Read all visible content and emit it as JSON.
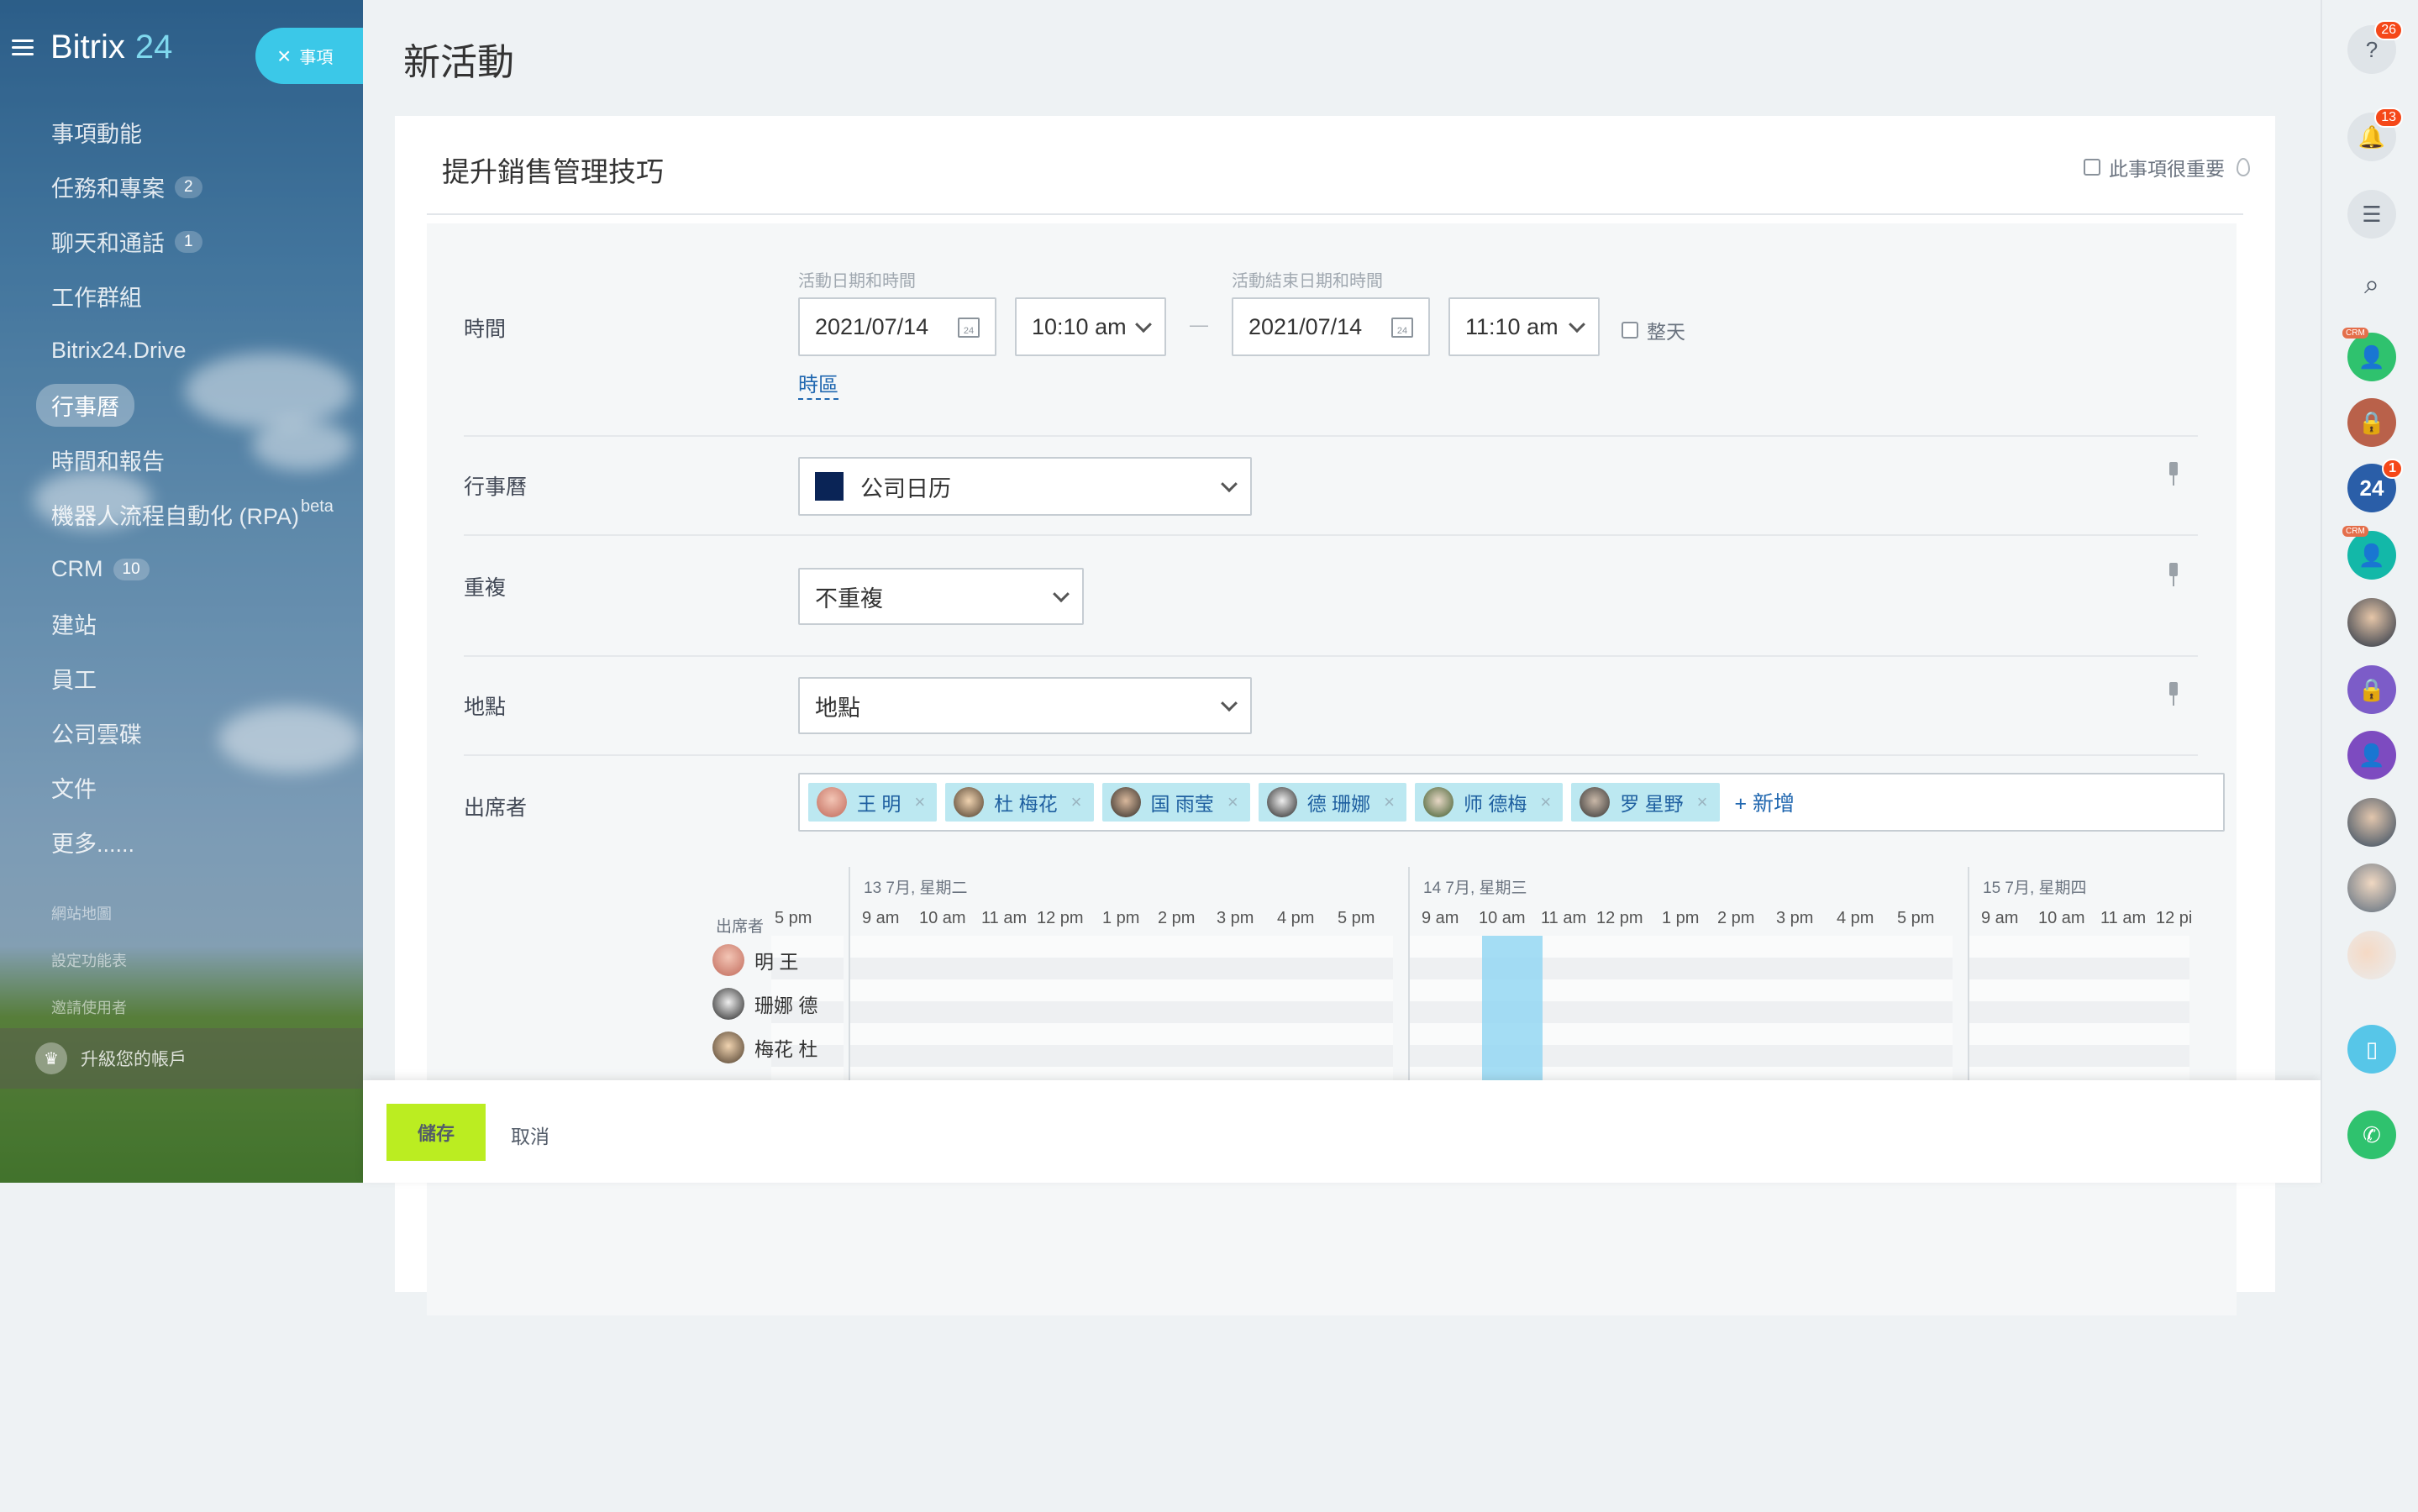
{
  "sidebar": {
    "logo": "Bitrix",
    "logo_num": "24",
    "event_button": "事項",
    "items": [
      {
        "label": "事項動能",
        "count": ""
      },
      {
        "label": "任務和專案",
        "count": "2"
      },
      {
        "label": "聊天和通話",
        "count": "1"
      },
      {
        "label": "工作群組",
        "count": ""
      },
      {
        "label": "Bitrix24.Drive",
        "count": ""
      },
      {
        "label": "行事曆",
        "count": "",
        "active": true
      },
      {
        "label": "時間和報告",
        "count": ""
      },
      {
        "label": "機器人流程自動化 (RPA)",
        "count": "",
        "sup": "beta"
      },
      {
        "label": "CRM",
        "count": "10"
      },
      {
        "label": "建站",
        "count": ""
      },
      {
        "label": "員工",
        "count": ""
      },
      {
        "label": "公司雲碟",
        "count": ""
      },
      {
        "label": "文件",
        "count": ""
      },
      {
        "label": "更多......",
        "count": ""
      }
    ],
    "sitemap": "網站地圖",
    "config_menu": "設定功能表",
    "invite": "邀請使用者",
    "upgrade": "升級您的帳戶"
  },
  "page": {
    "title": "新活動",
    "event_name": "提升銷售管理技巧",
    "important_label": "此事項很重要"
  },
  "form": {
    "time_label": "時間",
    "start_caption": "活動日期和時間",
    "end_caption": "活動結束日期和時間",
    "start_date": "2021/07/14",
    "start_time": "10:10 am",
    "end_date": "2021/07/14",
    "end_time": "11:10 am",
    "dash": "—",
    "allday": "整天",
    "timezone": "時區",
    "calendar_label": "行事曆",
    "calendar_value": "公司日历",
    "calendar_color": "#0a2456",
    "repeat_label": "重複",
    "repeat_value": "不重複",
    "location_label": "地點",
    "location_value": "地點",
    "attendees_label": "出席者",
    "attendees": [
      "王 明",
      "杜 梅花",
      "国 雨莹",
      "德 珊娜",
      "师 德梅",
      "罗 星野"
    ],
    "add": "新增"
  },
  "timeline": {
    "col_header": "出席者",
    "days": [
      "13 7月, 星期二",
      "14 7月, 星期三",
      "15 7月, 星期四"
    ],
    "prev_hour": "5 pm",
    "hours": [
      "9 am",
      "10 am",
      "11 am",
      "12 pm",
      "1 pm",
      "2 pm",
      "3 pm",
      "4 pm",
      "5 pm"
    ],
    "last_hours": [
      "9 am",
      "10 am",
      "11 am",
      "12 pi"
    ],
    "people": [
      "明 王",
      "珊娜 德",
      "梅花 杜"
    ]
  },
  "footer": {
    "save": "儲存",
    "cancel": "取消"
  },
  "rightbar": {
    "help_badge": "26",
    "bell_badge": "13",
    "crm_tag": "CRM",
    "b24_text": "24",
    "b24_badge": "1"
  }
}
